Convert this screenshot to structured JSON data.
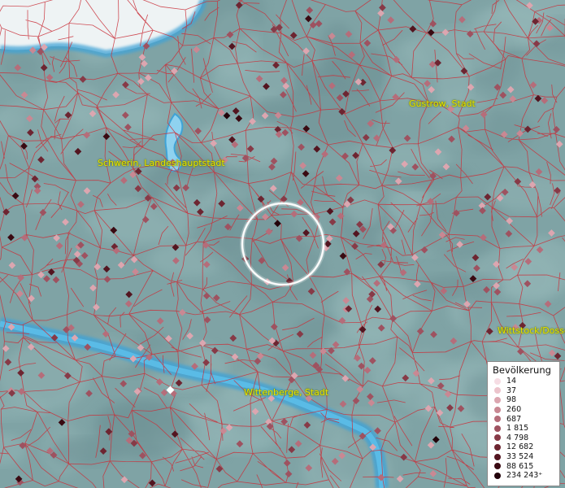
{
  "map": {
    "cities": [
      {
        "name": "Schwerin, Landeshauptstadt"
      },
      {
        "name": "Güstrow, Stadt"
      },
      {
        "name": "Wittenberge, Stadt"
      },
      {
        "name": "Wittstock/Dosse"
      }
    ],
    "colors": {
      "land": "#7fa3a5",
      "water": "#3fa3d6",
      "sea_ice": "#eef3f4",
      "boundary": "#c9303a",
      "label": "#e8e400",
      "selection_circle": "#ffffff"
    }
  },
  "legend": {
    "title": "Bevölkerung",
    "classes": [
      {
        "label": "14",
        "color": "#f6dde4"
      },
      {
        "label": "37",
        "color": "#ecc4cc"
      },
      {
        "label": "98",
        "color": "#dca6b0"
      },
      {
        "label": "260",
        "color": "#c98893"
      },
      {
        "label": "687",
        "color": "#b56d7a"
      },
      {
        "label": "1 815",
        "color": "#9e5260"
      },
      {
        "label": "4 798",
        "color": "#873a47"
      },
      {
        "label": "12 682",
        "color": "#6d2531"
      },
      {
        "label": "33 524",
        "color": "#531520"
      },
      {
        "label": "88 615",
        "color": "#3a0a12"
      },
      {
        "label": "234 243⁺",
        "color": "#22030a"
      }
    ]
  }
}
